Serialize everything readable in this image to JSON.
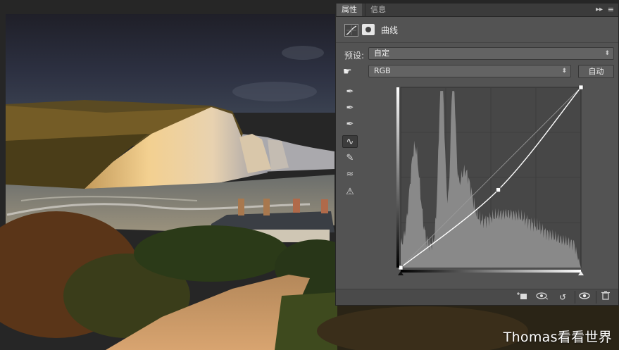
{
  "panel": {
    "tabs": [
      {
        "label": "属性",
        "active": true
      },
      {
        "label": "信息",
        "active": false
      }
    ],
    "collapse_label": "▸▸",
    "menu_label": "≡",
    "adjustment_title": "曲线",
    "preset_label": "预设:",
    "preset_value": "自定",
    "channel_value": "RGB",
    "auto_label": "自动",
    "tools": [
      {
        "name": "sample-black-point-icon",
        "glyph": "✎"
      },
      {
        "name": "sample-gray-point-icon",
        "glyph": "✎"
      },
      {
        "name": "sample-white-point-icon",
        "glyph": "✎"
      },
      {
        "name": "edit-points-curve-icon",
        "glyph": "∿"
      },
      {
        "name": "draw-pencil-icon",
        "glyph": "✎"
      },
      {
        "name": "smooth-curve-icon",
        "glyph": "≈"
      },
      {
        "name": "clipping-warning-icon",
        "glyph": "⚠"
      }
    ],
    "curve": {
      "input_range": [
        0,
        255
      ],
      "output_range": [
        0,
        255
      ],
      "points": [
        [
          0,
          0
        ],
        [
          138,
          110
        ],
        [
          255,
          255
        ]
      ],
      "histogram_color": "#8d8d8d"
    },
    "status_buttons": [
      {
        "name": "clip-to-layer-icon",
        "glyph": "⬚"
      },
      {
        "name": "view-previous-state-icon",
        "glyph": "👁"
      },
      {
        "name": "reset-adjustment-icon",
        "glyph": "↺"
      },
      {
        "name": "toggle-visibility-icon",
        "glyph": "👁"
      },
      {
        "name": "delete-adjustment-icon",
        "glyph": "🗑"
      }
    ]
  },
  "watermark": "Thomas看看世界",
  "colors": {
    "panel_bg": "#535353",
    "tabbar_bg": "#3b3b3b",
    "graph_bg": "#474747",
    "curve": "#ffffff"
  }
}
